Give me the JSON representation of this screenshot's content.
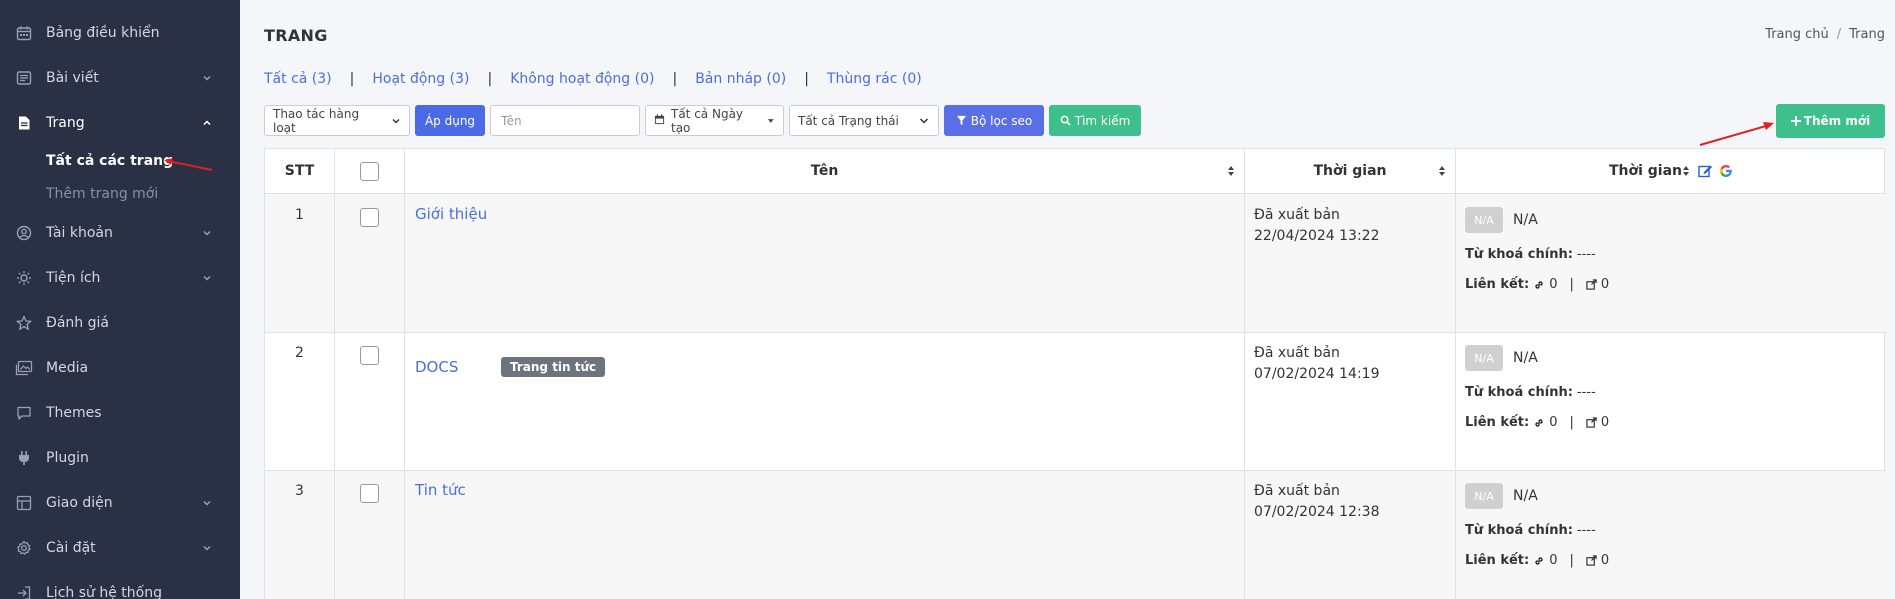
{
  "sidebar": {
    "items": [
      {
        "label": "Bảng điều khiển",
        "icon": "calendar-icon",
        "has_chevron": false
      },
      {
        "label": "Bài viết",
        "icon": "article-icon",
        "has_chevron": true
      },
      {
        "label": "Trang",
        "icon": "file-icon",
        "has_chevron": true
      },
      {
        "label": "Tài khoản",
        "icon": "user-circle-icon",
        "has_chevron": true
      },
      {
        "label": "Tiện ích",
        "icon": "sun-icon",
        "has_chevron": true
      },
      {
        "label": "Đánh giá",
        "icon": "star-icon",
        "has_chevron": false
      },
      {
        "label": "Media",
        "icon": "media-icon",
        "has_chevron": false
      },
      {
        "label": "Themes",
        "icon": "chat-icon",
        "has_chevron": false
      },
      {
        "label": "Plugin",
        "icon": "plug-icon",
        "has_chevron": false
      },
      {
        "label": "Giao diện",
        "icon": "layout-icon",
        "has_chevron": true
      },
      {
        "label": "Cài đặt",
        "icon": "gear-icon",
        "has_chevron": true
      },
      {
        "label": "Lịch sử hệ thống",
        "icon": "signin-icon",
        "has_chevron": false
      }
    ],
    "sub_items": [
      {
        "label": "Tất cả các trang"
      },
      {
        "label": "Thêm trang mới"
      }
    ]
  },
  "header": {
    "title": "TRANG",
    "breadcrumb": [
      "Trang chủ",
      "Trang"
    ]
  },
  "filters": [
    {
      "label": "Tất cả (3)"
    },
    {
      "label": "Hoạt động (3)"
    },
    {
      "label": "Không hoạt động (0)"
    },
    {
      "label": "Bản nháp (0)"
    },
    {
      "label": "Thùng rác (0)"
    }
  ],
  "toolbar": {
    "bulk_action": "Thao tác hàng loạt",
    "apply": "Áp dụng",
    "name_placeholder": "Tên",
    "date_filter": "Tất cả Ngày tạo",
    "status_filter": "Tất cả Trạng thái",
    "seo_filter": "Bộ lọc seo",
    "search": "Tìm kiếm",
    "add_new": "Thêm mới"
  },
  "table": {
    "headers": {
      "stt": "STT",
      "name": "Tên",
      "time": "Thời gian",
      "seo_time": "Thời gian"
    },
    "rows": [
      {
        "stt": "1",
        "name": "Giới thiệu",
        "tag": "",
        "status": "Đã xuất bản",
        "date": "22/04/2024 13:22",
        "na_badge": "N/A",
        "na_text": "N/A",
        "keyword_label": "Từ khoá chính:",
        "keyword_value": "----",
        "links_label": "Liên kết:",
        "internal_links": "0",
        "sep": "|",
        "external_links": "0"
      },
      {
        "stt": "2",
        "name": "DOCS",
        "tag": "Trang tin tức",
        "status": "Đã xuất bản",
        "date": "07/02/2024 14:19",
        "na_badge": "N/A",
        "na_text": "N/A",
        "keyword_label": "Từ khoá chính:",
        "keyword_value": "----",
        "links_label": "Liên kết:",
        "internal_links": "0",
        "sep": "|",
        "external_links": "0"
      },
      {
        "stt": "3",
        "name": "Tin tức",
        "tag": "",
        "status": "Đã xuất bản",
        "date": "07/02/2024 12:38",
        "na_badge": "N/A",
        "na_text": "N/A",
        "keyword_label": "Từ khoá chính:",
        "keyword_value": "----",
        "links_label": "Liên kết:",
        "internal_links": "0",
        "sep": "|",
        "external_links": "0"
      }
    ]
  },
  "colors": {
    "sidebar_bg": "#2b3145",
    "link": "#4a6fdc",
    "green": "#3ec08c",
    "annotation_arrow": "#e02020"
  }
}
